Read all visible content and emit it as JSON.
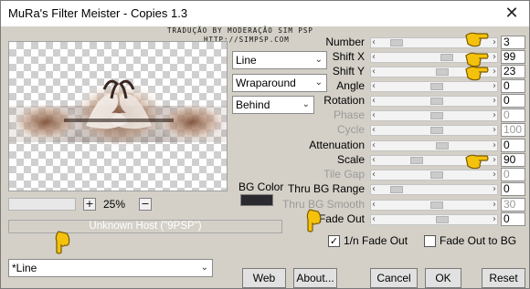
{
  "window": {
    "title": "MuRa's Filter Meister - Copies 1.3"
  },
  "credit": {
    "line1": "TRADUÇÃO BY MODERAÇÃO SIM PSP",
    "line2": "HTTP://SIMPSP.COM"
  },
  "zoom": {
    "value": "25%",
    "plus": "+",
    "minus": "−"
  },
  "host_text": "Unknown Host (\"9PSP\")",
  "dropdowns": {
    "mode": "Line",
    "edge": "Wraparound",
    "position": "Behind",
    "preset": "*Line"
  },
  "bg_color": {
    "label": "BG Color",
    "value": "#2b2a30"
  },
  "params": [
    {
      "label": "Number",
      "value": "3",
      "enabled": true,
      "fraction": 0.1
    },
    {
      "label": "Shift X",
      "value": "99",
      "enabled": true,
      "fraction": 0.6
    },
    {
      "label": "Shift Y",
      "value": "23",
      "enabled": true,
      "fraction": 0.55
    },
    {
      "label": "Angle",
      "value": "0",
      "enabled": true,
      "fraction": 0.5
    },
    {
      "label": "Rotation",
      "value": "0",
      "enabled": true,
      "fraction": 0.5
    },
    {
      "label": "Phase",
      "value": "0",
      "enabled": false,
      "fraction": 0.5
    },
    {
      "label": "Cycle",
      "value": "100",
      "enabled": false,
      "fraction": 0.5
    },
    {
      "label": "Attenuation",
      "value": "0",
      "enabled": true,
      "fraction": 0.55
    },
    {
      "label": "Scale",
      "value": "90",
      "enabled": true,
      "fraction": 0.3
    },
    {
      "label": "Tile Gap",
      "value": "0",
      "enabled": false,
      "fraction": 0.5
    },
    {
      "label": "Thru BG Range",
      "value": "0",
      "enabled": true,
      "fraction": 0.1
    },
    {
      "label": "Thru BG Smooth",
      "value": "30",
      "enabled": false,
      "fraction": 0.5
    },
    {
      "label": "Fade Out",
      "value": "0",
      "enabled": true,
      "fraction": 0.55
    }
  ],
  "checkboxes": [
    {
      "label": "1/n Fade Out",
      "checked": true
    },
    {
      "label": "Fade Out to BG",
      "checked": false
    }
  ],
  "buttons": {
    "web": "Web",
    "about": "About...",
    "cancel": "Cancel",
    "ok": "OK",
    "reset": "Reset"
  },
  "colors": {
    "face": "#d4d0c8",
    "hand": "#f4c20d",
    "hand_outline": "#7a5a00"
  }
}
